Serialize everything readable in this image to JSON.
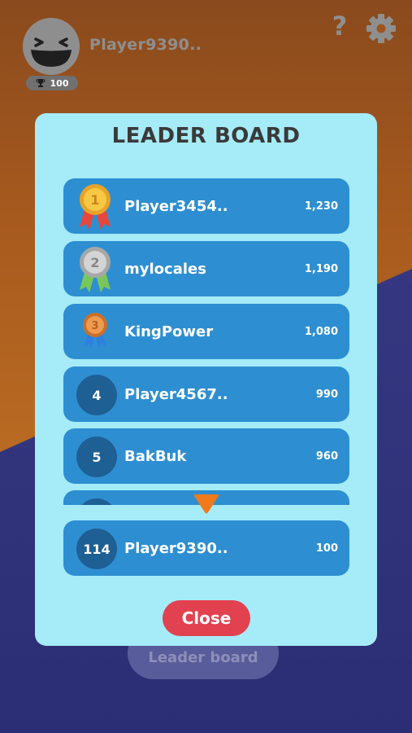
{
  "profile": {
    "name": "Player9390..",
    "trophies": "100"
  },
  "header_icons": {
    "help": "?",
    "settings": "gear-icon"
  },
  "background_button": {
    "label": "Leader board"
  },
  "leaderboard": {
    "title": "LEADER BOARD",
    "rows": [
      {
        "rank": "1",
        "name": "Player3454..",
        "score": "1,230",
        "medal": "gold"
      },
      {
        "rank": "2",
        "name": "mylocales",
        "score": "1,190",
        "medal": "silver"
      },
      {
        "rank": "3",
        "name": "KingPower",
        "score": "1,080",
        "medal": "bronze"
      },
      {
        "rank": "4",
        "name": "Player4567..",
        "score": "990"
      },
      {
        "rank": "5",
        "name": "BakBuk",
        "score": "960"
      }
    ],
    "self_row": {
      "rank": "114",
      "name": "Player9390..",
      "score": "100"
    },
    "close_label": "Close"
  },
  "colors": {
    "modal_bg": "#a6ebf8",
    "row_bg": "#2d8fd1",
    "rank_circle": "#1e5f94",
    "close_button": "#e2414f",
    "arrow": "#f07a1c"
  }
}
